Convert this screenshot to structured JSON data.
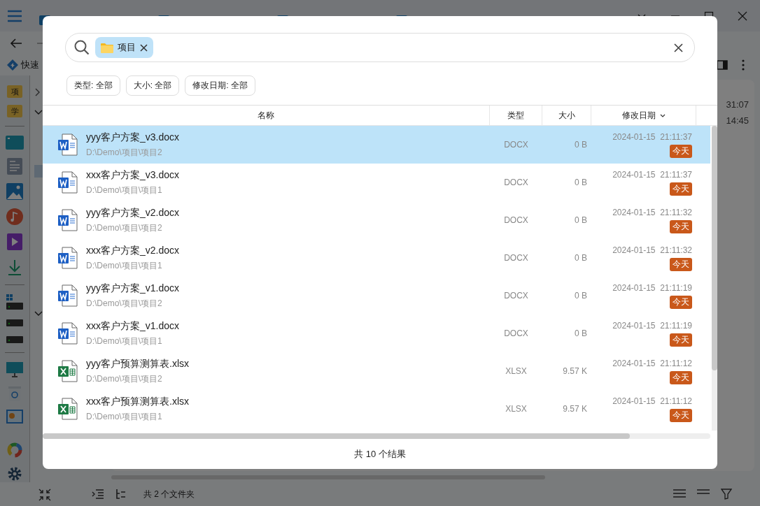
{
  "explorer": {
    "breadcrumb": "快速",
    "sidebar_folders": [
      "项",
      "学"
    ],
    "times": [
      "31:07",
      "14:45"
    ],
    "status": "共 2 个文件夹"
  },
  "search": {
    "chip": "项目"
  },
  "filters": [
    "类型: 全部",
    "大小: 全部",
    "修改日期: 全部"
  ],
  "columns": [
    {
      "label": "名称",
      "sorted": false
    },
    {
      "label": "类型",
      "sorted": false
    },
    {
      "label": "大小",
      "sorted": false
    },
    {
      "label": "修改日期",
      "sorted": true
    }
  ],
  "rows": [
    {
      "kind": "word",
      "name": "yyy客户方案_v3.docx",
      "path": "D:\\Demo\\项目\\项目2",
      "type": "DOCX",
      "size": "0 B",
      "modified": "2024-01-15  21:11:37",
      "badge": "今天",
      "selected": true
    },
    {
      "kind": "word",
      "name": "xxx客户方案_v3.docx",
      "path": "D:\\Demo\\项目\\项目1",
      "type": "DOCX",
      "size": "0 B",
      "modified": "2024-01-15  21:11:37",
      "badge": "今天",
      "selected": false
    },
    {
      "kind": "word",
      "name": "yyy客户方案_v2.docx",
      "path": "D:\\Demo\\项目\\项目2",
      "type": "DOCX",
      "size": "0 B",
      "modified": "2024-01-15  21:11:32",
      "badge": "今天",
      "selected": false
    },
    {
      "kind": "word",
      "name": "xxx客户方案_v2.docx",
      "path": "D:\\Demo\\项目\\项目1",
      "type": "DOCX",
      "size": "0 B",
      "modified": "2024-01-15  21:11:32",
      "badge": "今天",
      "selected": false
    },
    {
      "kind": "word",
      "name": "yyy客户方案_v1.docx",
      "path": "D:\\Demo\\项目\\项目2",
      "type": "DOCX",
      "size": "0 B",
      "modified": "2024-01-15  21:11:19",
      "badge": "今天",
      "selected": false
    },
    {
      "kind": "word",
      "name": "xxx客户方案_v1.docx",
      "path": "D:\\Demo\\项目\\项目1",
      "type": "DOCX",
      "size": "0 B",
      "modified": "2024-01-15  21:11:19",
      "badge": "今天",
      "selected": false
    },
    {
      "kind": "excel",
      "name": "yyy客户预算测算表.xlsx",
      "path": "D:\\Demo\\项目\\项目2",
      "type": "XLSX",
      "size": "9.57 K",
      "modified": "2024-01-15  21:11:12",
      "badge": "今天",
      "selected": false
    },
    {
      "kind": "excel",
      "name": "xxx客户预算测算表.xlsx",
      "path": "D:\\Demo\\项目\\项目1",
      "type": "XLSX",
      "size": "9.57 K",
      "modified": "2024-01-15  21:11:12",
      "badge": "今天",
      "selected": false
    }
  ],
  "footer": "共 10 个结果"
}
